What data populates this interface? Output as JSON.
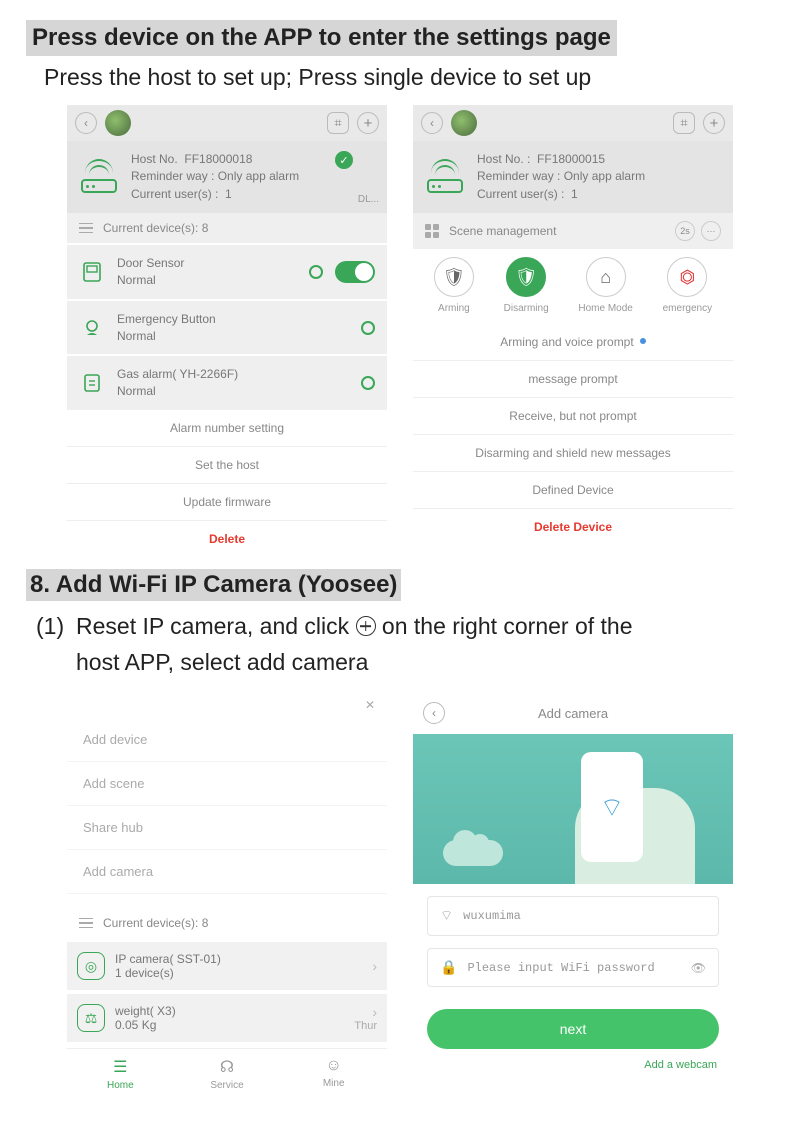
{
  "doc": {
    "heading": "Press device on the APP to enter the settings page",
    "subheading": "Press the host to set up; Press single device to set up",
    "section_title": "8. Add Wi-Fi IP Camera (Yoosee)",
    "step1_num": "(1)",
    "step1_a": "Reset IP camera, and click",
    "step1_b": "on the right corner of the",
    "step1_c": "host APP, select add camera"
  },
  "shotA": {
    "host_no_label": "Host No.",
    "host_no": "FF18000018",
    "reminder_label": "Reminder way :",
    "reminder_value": "Only app alarm",
    "users_label": "Current user(s) :",
    "users_value": "1",
    "dl": "DL...",
    "devices_header": "Current device(s):  8",
    "items": [
      {
        "name": "Door Sensor",
        "status": "Normal"
      },
      {
        "name": "Emergency Button",
        "status": "Normal"
      },
      {
        "name": "Gas alarm( YH-2266F)",
        "status": "Normal"
      }
    ],
    "menu": [
      "Alarm number setting",
      "Set the host",
      "Update firmware"
    ],
    "delete": "Delete"
  },
  "shotB": {
    "host_no_label": "Host No. :",
    "host_no": "FF18000015",
    "reminder_label": "Reminder way :",
    "reminder_value": "Only app alarm",
    "users_label": "Current user(s) :",
    "users_value": "1",
    "scene_header": "Scene management",
    "chips": [
      "2s",
      "···"
    ],
    "scenes": [
      {
        "label": "Arming"
      },
      {
        "label": "Disarming"
      },
      {
        "label": "Home Mode"
      },
      {
        "label": "emergency"
      }
    ],
    "options": [
      "Arming and voice prompt",
      "message prompt",
      "Receive, but not prompt",
      "Disarming and shield new messages",
      "Defined Device"
    ],
    "delete": "Delete Device"
  },
  "shotC": {
    "popup": [
      "Add device",
      "Add scene",
      "Share hub",
      "Add camera"
    ],
    "devices_header": "Current device(s):  8",
    "rows": [
      {
        "name": "IP camera( SST-01)",
        "sub": "1 device(s)",
        "meta": ""
      },
      {
        "name": "weight( X3)",
        "sub": "0.05 Kg",
        "meta": "Thur"
      }
    ],
    "nav": [
      "Home",
      "Service",
      "Mine"
    ]
  },
  "shotD": {
    "title": "Add camera",
    "ssid": "wuxumima",
    "pwd_placeholder": "Please input WiFi password",
    "next": "next",
    "webcam": "Add a webcam"
  }
}
